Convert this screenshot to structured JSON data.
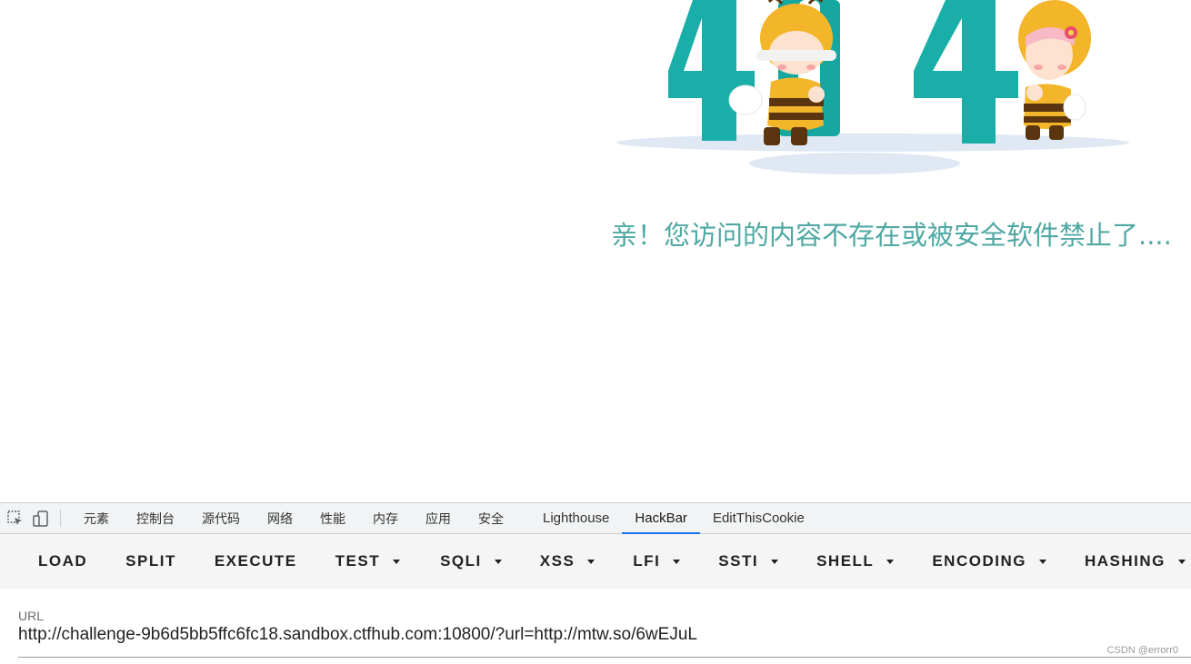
{
  "main": {
    "message": "亲！您访问的内容不存在或被安全软件禁止了....",
    "illustration": "404-bees-illustration",
    "accent_color": "#4fa8a3"
  },
  "devtools": {
    "tabs": [
      {
        "label": "元素"
      },
      {
        "label": "控制台"
      },
      {
        "label": "源代码"
      },
      {
        "label": "网络"
      },
      {
        "label": "性能"
      },
      {
        "label": "内存"
      },
      {
        "label": "应用"
      },
      {
        "label": "安全"
      },
      {
        "label": "Lighthouse"
      },
      {
        "label": "HackBar"
      },
      {
        "label": "EditThisCookie"
      }
    ],
    "active_tab": "HackBar"
  },
  "hackbar": {
    "buttons": [
      {
        "label": "LOAD"
      },
      {
        "label": "SPLIT"
      },
      {
        "label": "EXECUTE"
      },
      {
        "label": "TEST"
      },
      {
        "label": "SQLI"
      },
      {
        "label": "XSS"
      },
      {
        "label": "LFI"
      },
      {
        "label": "SSTI"
      },
      {
        "label": "SHELL"
      },
      {
        "label": "ENCODING"
      },
      {
        "label": "HASHING"
      }
    ],
    "url_label": "URL",
    "url_value": "http://challenge-9b6d5bb5ffc6fc18.sandbox.ctfhub.com:10800/?url=http://mtw.so/6wEJuL"
  },
  "watermark": "CSDN @errorr0"
}
